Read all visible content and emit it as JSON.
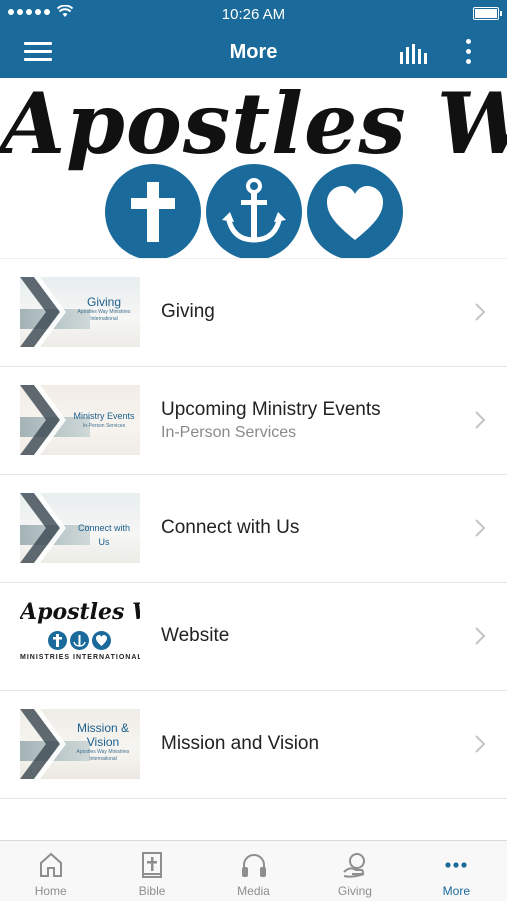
{
  "status_bar": {
    "time": "10:26 AM"
  },
  "nav": {
    "title": "More"
  },
  "banner": {
    "title": "Apostles Way",
    "icons": [
      "cross-icon",
      "anchor-icon",
      "heart-icon"
    ]
  },
  "items": [
    {
      "title": "Giving",
      "subtitle": "",
      "thumb_title": "Giving",
      "thumb_sub": "Apostles Way Ministries International"
    },
    {
      "title": "Upcoming Ministry Events",
      "subtitle": "In-Person Services",
      "thumb_title": "Ministry Events",
      "thumb_sub": "In-Person Services"
    },
    {
      "title": "Connect with Us",
      "subtitle": "",
      "thumb_title": "Connect with Us",
      "thumb_sub": ""
    },
    {
      "title": "Website",
      "subtitle": "",
      "logo_title": "Apostles Way",
      "logo_sub": "MINISTRIES INTERNATIONAL"
    },
    {
      "title": "Mission and Vision",
      "subtitle": "",
      "thumb_title": "Mission & Vision",
      "thumb_sub": "Apostles Way Ministries International"
    }
  ],
  "tabs": [
    {
      "label": "Home",
      "icon": "home-icon"
    },
    {
      "label": "Bible",
      "icon": "bible-icon"
    },
    {
      "label": "Media",
      "icon": "headphones-icon"
    },
    {
      "label": "Giving",
      "icon": "giving-icon"
    },
    {
      "label": "More",
      "icon": "more-horizontal-icon"
    }
  ],
  "colors": {
    "primary": "#1b6a9c",
    "tab_inactive": "#8e8e8e"
  }
}
